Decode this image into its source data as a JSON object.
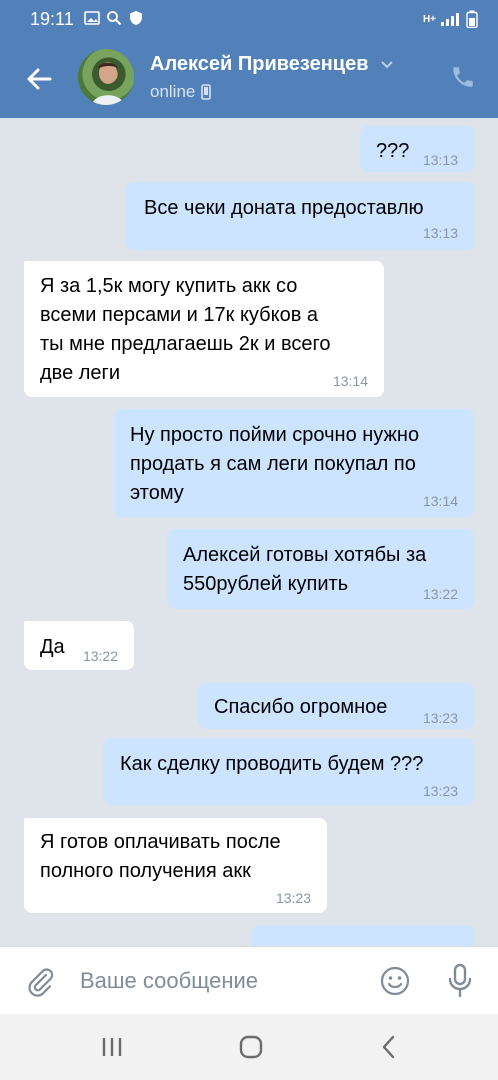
{
  "status_bar": {
    "time": "19:11",
    "network": "H+"
  },
  "header": {
    "contact_name": "Алексей Привезенцев",
    "presence": "online"
  },
  "messages": [
    {
      "dir": "out",
      "lines": [
        "???"
      ],
      "time": "13:13"
    },
    {
      "dir": "out",
      "lines": [
        "Все чеки доната предоставлю"
      ],
      "time": "13:13"
    },
    {
      "dir": "in",
      "lines": [
        "Я за 1,5к могу купить акк со",
        "всеми персами и 17к кубков а",
        "ты мне предлагаешь 2к и всего",
        "две леги"
      ],
      "time": "13:14"
    },
    {
      "dir": "out",
      "lines": [
        "Ну просто пойми срочно нужно",
        "продать я сам леги покупал по",
        "этому"
      ],
      "time": "13:14"
    },
    {
      "dir": "out",
      "lines": [
        "Алексей готовы хотябы за",
        "550рублей купить"
      ],
      "time": "13:22"
    },
    {
      "dir": "in",
      "lines": [
        "Да"
      ],
      "time": "13:22"
    },
    {
      "dir": "out",
      "lines": [
        "Спасибо огромное"
      ],
      "time": "13:23"
    },
    {
      "dir": "out",
      "lines": [
        "Как сделку проводить будем ???"
      ],
      "time": "13:23"
    },
    {
      "dir": "in",
      "lines": [
        "Я готов оплачивать после",
        "полного получения акк"
      ],
      "time": "13:23"
    }
  ],
  "composer": {
    "placeholder": "Ваше сообщение"
  },
  "colors": {
    "header": "#5181b8",
    "outgoing_bubble": "#cce4ff",
    "incoming_bubble": "#ffffff",
    "chat_bg": "#dfe4ea"
  },
  "icons": [
    "back-arrow-icon",
    "chevron-down-icon",
    "mobile-icon",
    "phone-icon",
    "attach-icon",
    "emoji-icon",
    "microphone-icon",
    "recent-apps-icon",
    "home-icon",
    "nav-back-icon"
  ]
}
